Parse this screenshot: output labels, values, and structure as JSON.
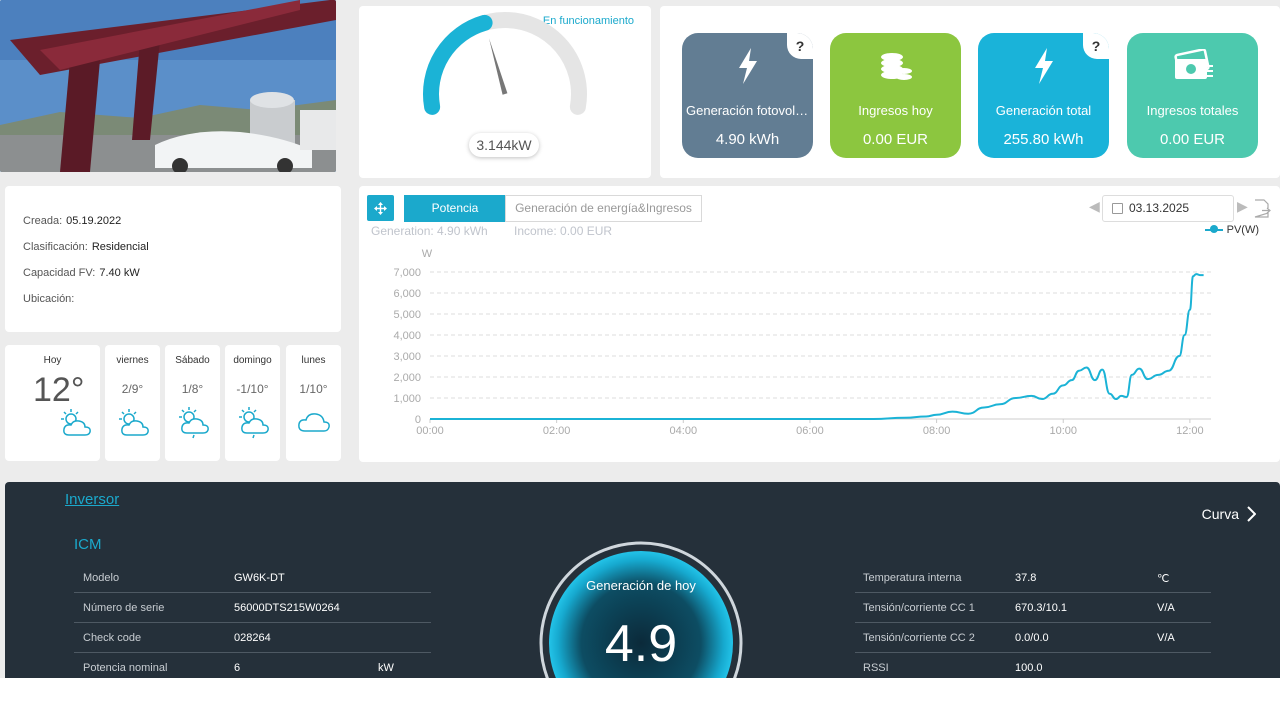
{
  "status": {
    "label": "En funcionamiento",
    "power_value": "3.144kW",
    "gauge_fraction": 0.42
  },
  "stats": [
    {
      "label": "Generación fotovoltaica",
      "value": "4.90 kWh",
      "color": "#627d93",
      "icon": "bolt-icon",
      "help": "?"
    },
    {
      "label": "Ingresos hoy",
      "value": "0.00 EUR",
      "color": "#8cc63f",
      "icon": "coins-icon"
    },
    {
      "label": "Generación total",
      "value": "255.80 kWh",
      "color": "#1ab3d9",
      "icon": "bolt-icon",
      "help": "?"
    },
    {
      "label": "Ingresos totales",
      "value": "0.00 EUR",
      "color": "#4dc9ae",
      "icon": "money-icon"
    }
  ],
  "info": [
    {
      "label": "Creada:",
      "value": "05.19.2022"
    },
    {
      "label": "Clasificación:",
      "value": "Residencial"
    },
    {
      "label": "Capacidad FV:",
      "value": "7.40 kW"
    },
    {
      "label": "Ubicación:",
      "value": ""
    }
  ],
  "weather": {
    "today": {
      "day": "Hoy",
      "temp": "12°",
      "icon": "sun-cloud-icon"
    },
    "forecast": [
      {
        "day": "viernes",
        "range": "2/9°",
        "icon": "sun-cloud-icon"
      },
      {
        "day": "Sábado",
        "range": "1/8°",
        "icon": "sun-cloud-rain-icon"
      },
      {
        "day": "domingo",
        "range": "-1/10°",
        "icon": "sun-cloud-rain-icon"
      },
      {
        "day": "lunes",
        "range": "1/10°",
        "icon": "cloud-icon"
      }
    ]
  },
  "chart_panel": {
    "tabs": [
      {
        "label": "Potencia",
        "active": true
      },
      {
        "label": "Generación de energía&Ingresos",
        "active": false
      }
    ],
    "summary_generation": "Generation: 4.90 kWh",
    "summary_income": "Income: 0.00 EUR",
    "date": "03.13.2025",
    "legend": "PV(W)"
  },
  "chart_data": {
    "type": "line",
    "ylabel": "W",
    "ylim": [
      0,
      7000
    ],
    "yticks": [
      "0",
      "1,000",
      "2,000",
      "3,000",
      "4,000",
      "5,000",
      "6,000",
      "7,000"
    ],
    "xticks": [
      "00:00",
      "02:00",
      "04:00",
      "06:00",
      "08:00",
      "10:00",
      "12:00"
    ],
    "grid": true,
    "series": [
      {
        "name": "PV(W)",
        "x": [
          0,
          60,
          120,
          180,
          240,
          300,
          360,
          420,
          450,
          470,
          480,
          495,
          510,
          525,
          540,
          555,
          570,
          580,
          590,
          600,
          608,
          615,
          622,
          630,
          637,
          644,
          650,
          655,
          660,
          665,
          672,
          680,
          690,
          700,
          710,
          715,
          720,
          723,
          726,
          730,
          733
        ],
        "values": [
          0,
          0,
          0,
          0,
          0,
          0,
          0,
          0,
          60,
          120,
          200,
          350,
          250,
          550,
          700,
          1000,
          1100,
          950,
          1200,
          1600,
          1850,
          2300,
          2450,
          1850,
          2350,
          1200,
          950,
          1100,
          1050,
          2100,
          2400,
          1900,
          2100,
          2300,
          3000,
          4000,
          5200,
          6800,
          6900,
          6850,
          6850
        ]
      }
    ]
  },
  "inverter": {
    "link": "Inversor",
    "curve": "Curva",
    "name": "ICM",
    "left_rows": [
      {
        "label": "Modelo",
        "value": "GW6K-DT",
        "unit": ""
      },
      {
        "label": "Número de serie",
        "value": "56000DTS215W0264",
        "unit": ""
      },
      {
        "label": "Check code",
        "value": "028264",
        "unit": ""
      },
      {
        "label": "Potencia nominal",
        "value": "6",
        "unit": "kW"
      }
    ],
    "right_rows": [
      {
        "label": "Temperatura interna",
        "value": "37.8",
        "unit": "℃"
      },
      {
        "label": "Tensión/corriente CC 1",
        "value": "670.3/10.1",
        "unit": "V/A"
      },
      {
        "label": "Tensión/corriente CC 2",
        "value": "0.0/0.0",
        "unit": "V/A"
      },
      {
        "label": "RSSI",
        "value": "100.0",
        "unit": ""
      }
    ],
    "today_label": "Generación de hoy",
    "today_value": "4.9"
  }
}
